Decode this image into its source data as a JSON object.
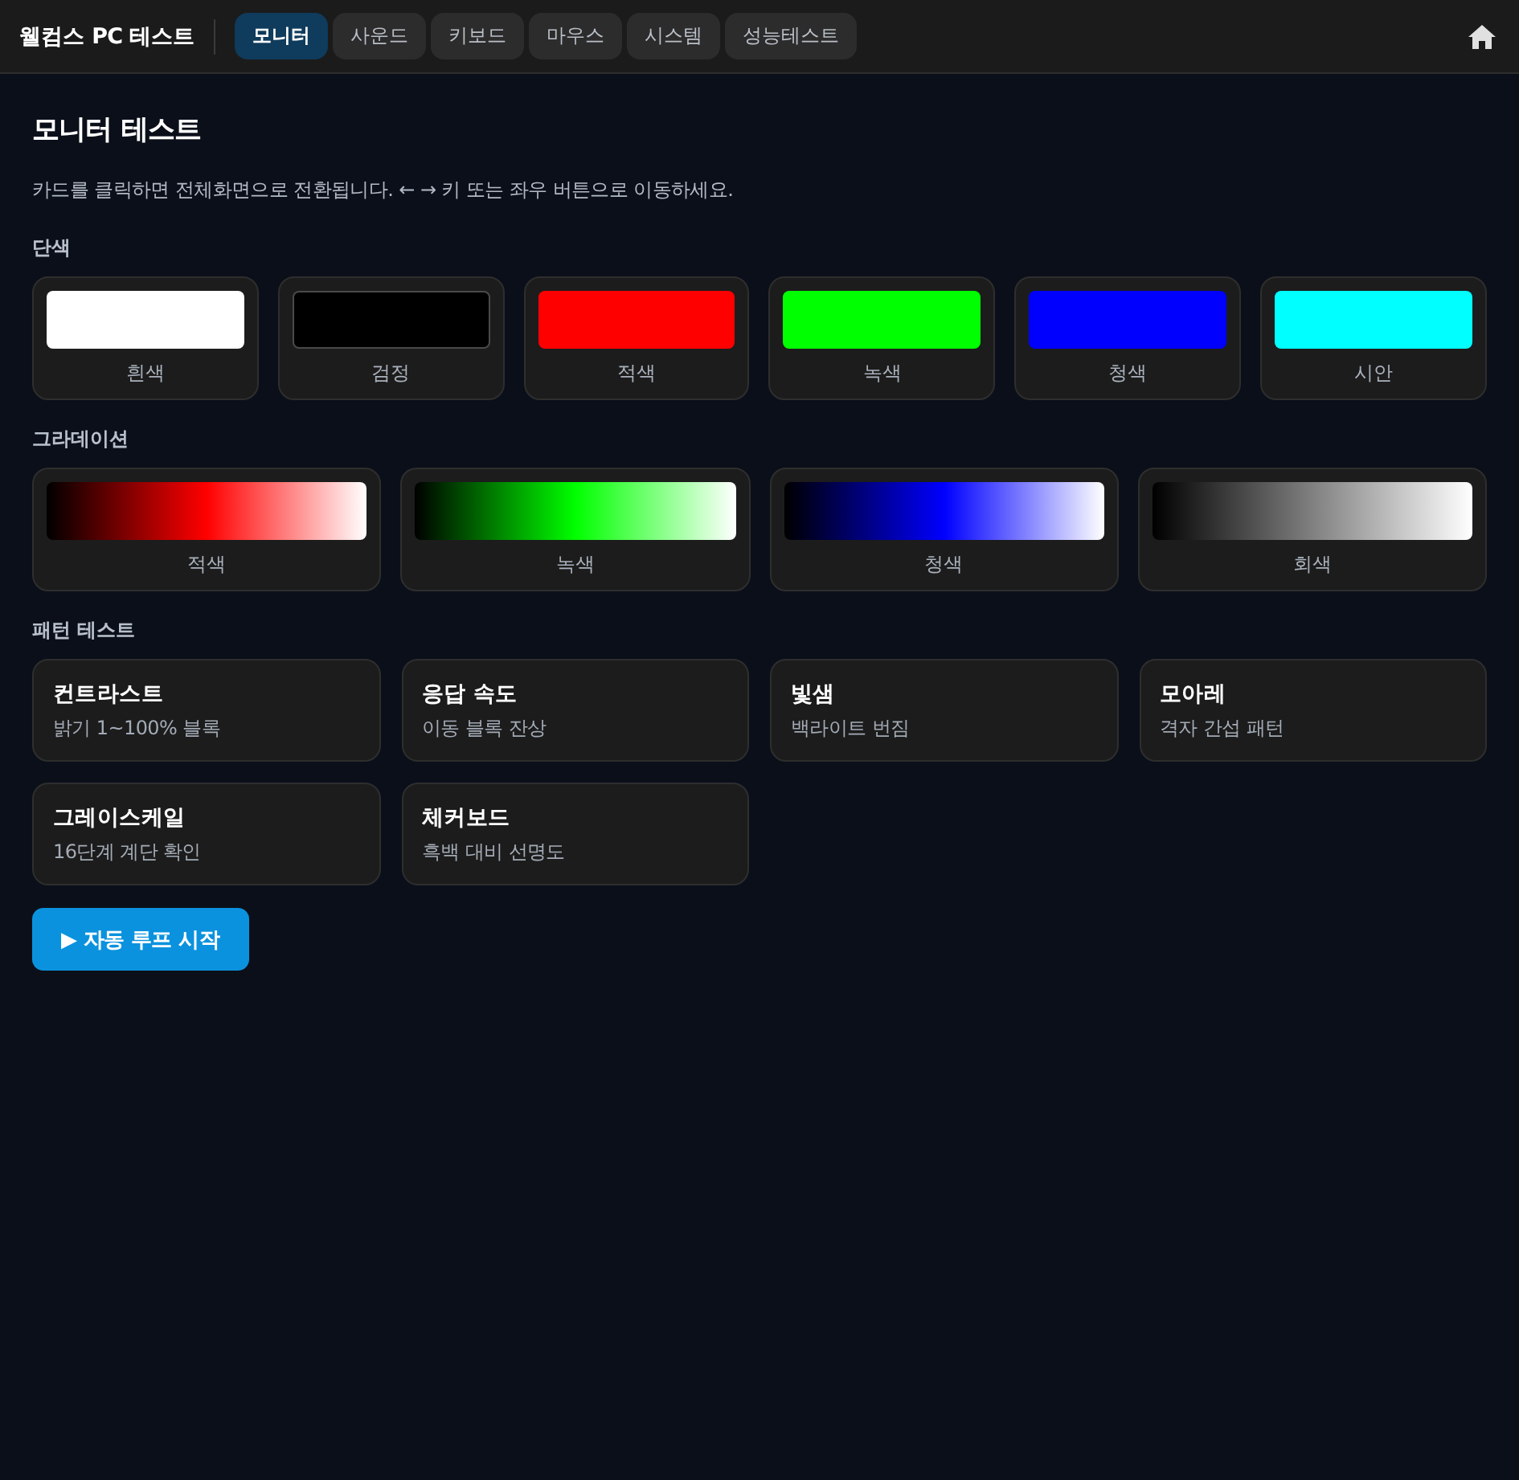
{
  "header": {
    "brand": "웰컴스 PC 테스트",
    "tabs": [
      {
        "label": "모니터",
        "selected": true
      },
      {
        "label": "사운드",
        "selected": false
      },
      {
        "label": "키보드",
        "selected": false
      },
      {
        "label": "마우스",
        "selected": false
      },
      {
        "label": "시스템",
        "selected": false
      },
      {
        "label": "성능테스트",
        "selected": false
      }
    ]
  },
  "page": {
    "title": "모니터 테스트",
    "description": "카드를 클릭하면 전체화면으로 전환됩니다. ← → 키 또는 좌우 버튼으로 이동하세요."
  },
  "solid": {
    "heading": "단색",
    "items": [
      {
        "label": "흰색",
        "color": "#ffffff"
      },
      {
        "label": "검정",
        "color": "#000000"
      },
      {
        "label": "적색",
        "color": "#ff0000"
      },
      {
        "label": "녹색",
        "color": "#00ff00"
      },
      {
        "label": "청색",
        "color": "#0000ff"
      },
      {
        "label": "시안",
        "color": "#00ffff"
      }
    ]
  },
  "gradient": {
    "heading": "그라데이션",
    "items": [
      {
        "label": "적색",
        "color": "#ff0000"
      },
      {
        "label": "녹색",
        "color": "#00ff00"
      },
      {
        "label": "청색",
        "color": "#0000ff"
      },
      {
        "label": "회색",
        "color": "#808080"
      }
    ]
  },
  "patterns": {
    "heading": "패턴 테스트",
    "items": [
      {
        "title": "컨트라스트",
        "subtitle": "밝기 1~100% 블록"
      },
      {
        "title": "응답 속도",
        "subtitle": "이동 블록 잔상"
      },
      {
        "title": "빛샘",
        "subtitle": "백라이트 번짐"
      },
      {
        "title": "모아레",
        "subtitle": "격자 간섭 패턴"
      },
      {
        "title": "그레이스케일",
        "subtitle": "16단계 계단 확인"
      },
      {
        "title": "체커보드",
        "subtitle": "흑백 대비 선명도"
      }
    ]
  },
  "auto_loop_button": {
    "label": "▶ 자동 루프 시작"
  }
}
